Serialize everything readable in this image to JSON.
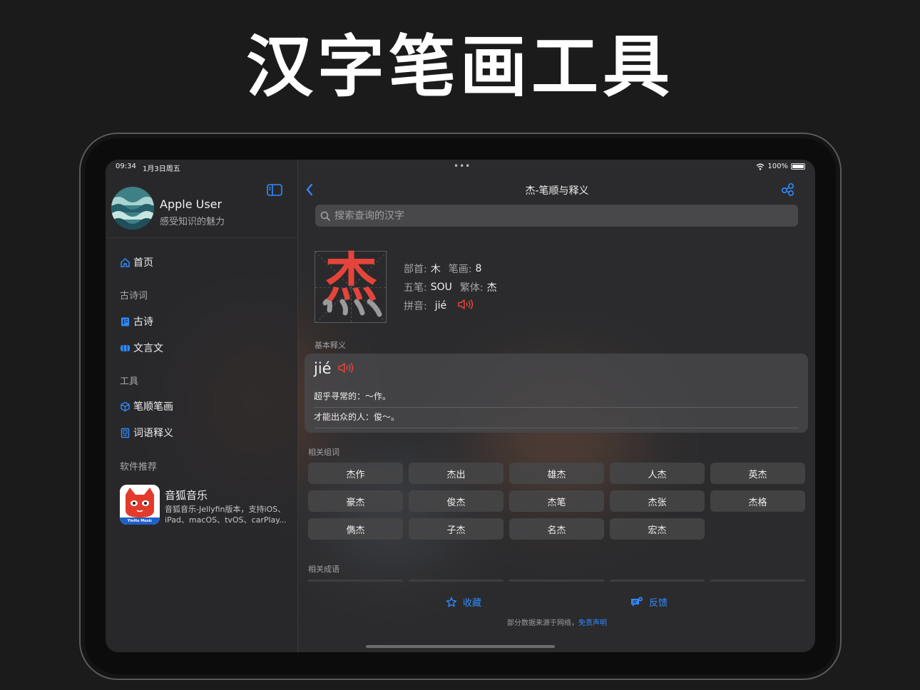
{
  "headline": "汉字笔画工具",
  "status": {
    "time": "09:34",
    "date": "1月3日周五",
    "wifi": "wifi-icon",
    "battery_percent": "100%"
  },
  "sidebar": {
    "user_name": "Apple User",
    "user_subtitle": "感受知识的魅力",
    "toggle_icon": "sidebar-toggle-icon",
    "items": [
      {
        "label": "首页",
        "icon": "home-icon"
      },
      {
        "section": "古诗词"
      },
      {
        "label": "古诗",
        "icon": "book-icon"
      },
      {
        "label": "文言文",
        "icon": "scroll-icon"
      },
      {
        "section": "工具"
      },
      {
        "label": "笔顺笔画",
        "icon": "cube-icon"
      },
      {
        "label": "词语释义",
        "icon": "dictionary-icon"
      },
      {
        "section": "软件推荐"
      }
    ],
    "recommend": {
      "title": "音狐音乐",
      "desc": "音狐音乐-Jellyfin版本，支持iOS、iPad、macOS、tvOS、carPlay...",
      "icon_caption": "YinHu Music"
    }
  },
  "main": {
    "title": "杰-笔顺与释义",
    "search_placeholder": "搜索查询的汉字",
    "character": "杰",
    "radical_label": "部首:",
    "radical": "木",
    "strokes_label": "笔画:",
    "strokes": "8",
    "wubi_label": "五笔:",
    "wubi": "SOU",
    "traditional_label": "繁体:",
    "traditional": "杰",
    "pinyin_label": "拼音:",
    "pinyin": "jié",
    "basic_meaning_label": "基本释义",
    "definitions": [
      "超乎寻常的：～作。",
      "才能出众的人：俊～。"
    ],
    "related_words_label": "相关组词",
    "related_words": [
      "杰作",
      "杰出",
      "雄杰",
      "人杰",
      "英杰",
      "豪杰",
      "俊杰",
      "杰笔",
      "杰张",
      "杰格",
      "儁杰",
      "子杰",
      "名杰",
      "宏杰"
    ],
    "related_idioms_label": "相关成语",
    "favorite_label": "收藏",
    "feedback_label": "反馈",
    "footer_note": "部分数据来源于网络，",
    "footer_link": "免责声明"
  },
  "colors": {
    "accent": "#2f8bff",
    "stroke_red": "#e5443a",
    "background": "#1b1b1c"
  }
}
